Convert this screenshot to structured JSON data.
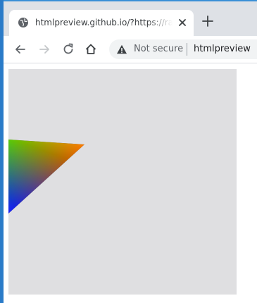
{
  "browser": {
    "tab": {
      "title": "htmlpreview.github.io/?https://raw.githubusercontent.com/",
      "favicon": "globe-icon",
      "close_icon": "close-icon"
    },
    "new_tab_icon": "plus-icon",
    "toolbar": {
      "back_icon": "arrow-left-icon",
      "forward_icon": "arrow-right-icon",
      "reload_icon": "reload-icon",
      "home_icon": "home-icon"
    },
    "omnibox": {
      "security_icon": "warning-triangle-icon",
      "security_label": "Not secure",
      "url": "htmlpreview"
    }
  },
  "content": {
    "canvas_background": "#dfdfe1",
    "shape": "triangle",
    "gradient_colors": [
      "#ff2a00",
      "#00c800",
      "#1a1aff"
    ]
  },
  "colors": {
    "window_frame": "#dee1e6",
    "desktop": "#3a8fd6"
  }
}
